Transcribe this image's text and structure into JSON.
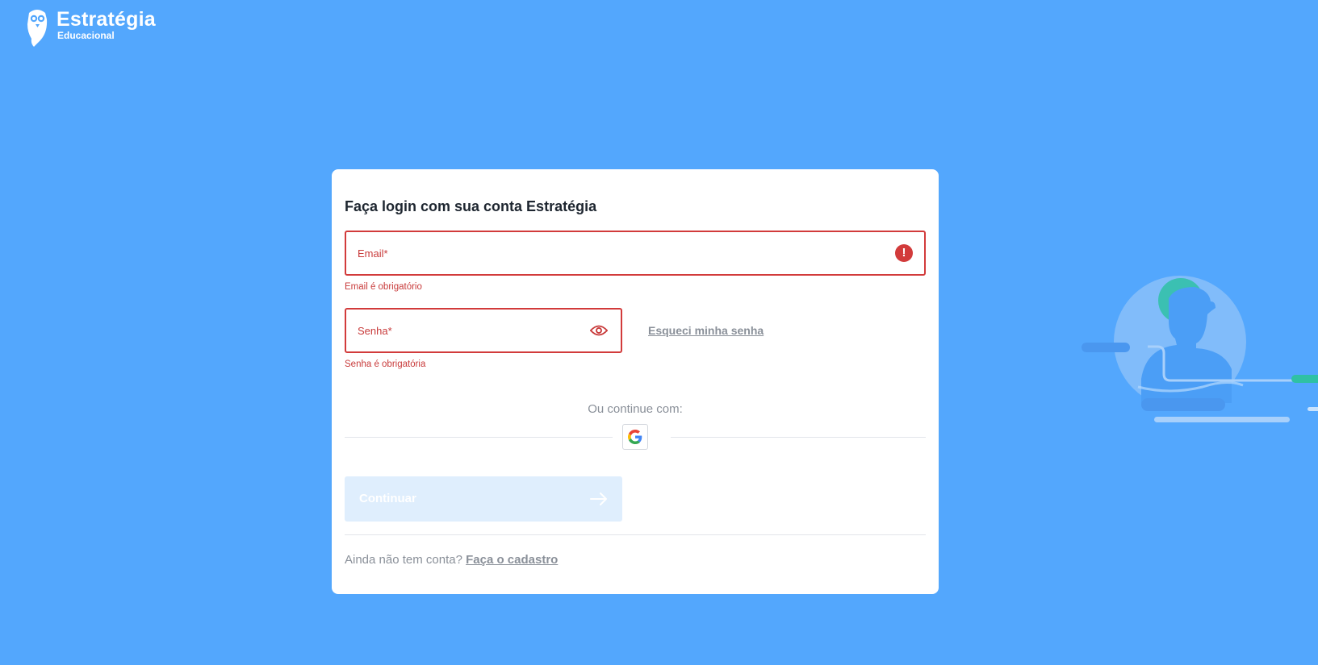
{
  "brand": {
    "name": "Estratégia",
    "subtitle": "Educacional"
  },
  "login": {
    "title": "Faça login com sua conta Estratégia",
    "email": {
      "label": "Email*",
      "value": "",
      "error": "Email é obrigatório",
      "icon": "error-icon"
    },
    "password": {
      "label": "Senha*",
      "value": "",
      "error": "Senha é obrigatória",
      "icon": "eye-icon"
    },
    "forgot_password": "Esqueci minha senha",
    "or_continue": "Ou continue com:",
    "google_icon": "google-icon",
    "continue_button": "Continuar",
    "continue_icon": "arrow-right-icon",
    "signup_prompt": "Ainda não tem conta?",
    "signup_link": "Faça o cadastro"
  },
  "colors": {
    "background": "#53a7fd",
    "error": "#d23b3b",
    "button_disabled": "#dfeefd",
    "muted_text": "#8a9099"
  }
}
